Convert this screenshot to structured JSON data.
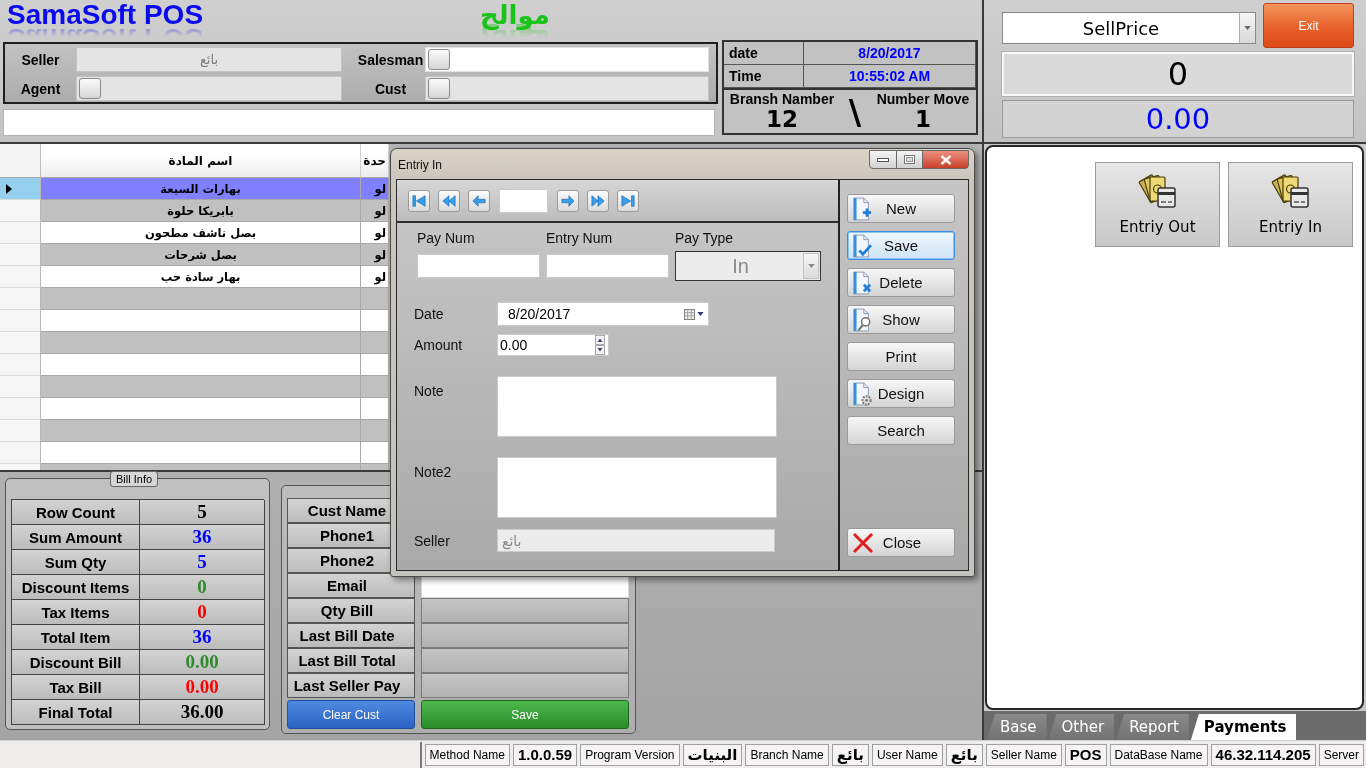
{
  "header": {
    "logo": "SamaSoft POS",
    "brand": "موالح"
  },
  "seller_form": {
    "fields": [
      {
        "label": "Seller",
        "kind": "text",
        "value": "بائع",
        "disabled": true
      },
      {
        "label": "Salesman",
        "kind": "lookup",
        "disabled": false
      },
      {
        "label": "Agent",
        "kind": "lookup",
        "disabled": true
      },
      {
        "label": "Cust",
        "kind": "lookup",
        "disabled": true
      }
    ]
  },
  "doc_info": {
    "rows": [
      {
        "label": "date",
        "value": "8/20/2017"
      },
      {
        "label": "Time",
        "value": "10:55:02 AM"
      }
    ],
    "branch_label": "Bransh Namber",
    "branch": "12",
    "separator": "\\",
    "move_label": "Number Move",
    "move": "1"
  },
  "price_panel": {
    "price_type": "SellPrice",
    "exit": "Exit",
    "quantity": "0",
    "total": "0.00"
  },
  "grid": {
    "columns": [
      "اسم المادة",
      "حدة"
    ],
    "rows": [
      {
        "cells": [
          "بهارات السبعة",
          "لو"
        ],
        "selected": true
      },
      {
        "cells": [
          "بابريكا حلوة",
          "لو"
        ],
        "selected": false
      },
      {
        "cells": [
          "بصل ناشف مطحون",
          "لو"
        ],
        "selected": false
      },
      {
        "cells": [
          "بصل شرحات",
          "لو"
        ],
        "selected": false
      },
      {
        "cells": [
          "بهار سادة حب",
          "لو"
        ],
        "selected": false
      }
    ]
  },
  "dialog": {
    "title": "Entriy In",
    "top_fields": [
      {
        "label": "Pay Num",
        "kind": "text",
        "disabled": false
      },
      {
        "label": "Entry Num",
        "kind": "text",
        "disabled": false
      },
      {
        "label": "Pay Type",
        "kind": "combo",
        "value": "In",
        "disabled": true
      }
    ],
    "fields": [
      {
        "label": "Date",
        "kind": "date",
        "value": "8/20/2017",
        "disabled": false
      },
      {
        "label": "Amount",
        "kind": "number",
        "value": "0.00",
        "disabled": false
      },
      {
        "label": "Note",
        "kind": "memo",
        "disabled": false
      },
      {
        "label": "Note2",
        "kind": "memo",
        "disabled": false
      },
      {
        "label": "Seller",
        "kind": "text",
        "value": "بائع",
        "disabled": true
      }
    ],
    "buttons": [
      {
        "label": "New",
        "kind": "new",
        "focused": false
      },
      {
        "label": "Save",
        "kind": "save",
        "focused": true
      },
      {
        "label": "Delete",
        "kind": "delete",
        "focused": false
      },
      {
        "label": "Show",
        "kind": "show",
        "focused": false
      },
      {
        "label": "Print",
        "kind": "print",
        "focused": false
      },
      {
        "label": "Design",
        "kind": "design",
        "focused": false
      },
      {
        "label": "Search",
        "kind": "search",
        "focused": false
      },
      {
        "label": "Close",
        "kind": "close",
        "focused": false
      }
    ]
  },
  "bill_info": {
    "title": "Bill Info",
    "rows": [
      {
        "label": "Row Count",
        "value": "5",
        "color": "#000000"
      },
      {
        "label": "Sum Amount",
        "value": "36",
        "color": "#0000ff"
      },
      {
        "label": "Sum Qty",
        "value": "5",
        "color": "#0000ff"
      },
      {
        "label": "Discount Items",
        "value": "0",
        "color": "#2e8b2e"
      },
      {
        "label": "Tax Items",
        "value": "0",
        "color": "#ff0000"
      },
      {
        "label": "Total Item",
        "value": "36",
        "color": "#0000ff"
      },
      {
        "label": "Discount Bill",
        "value": "0.00",
        "color": "#2e8b2e"
      },
      {
        "label": "Tax Bill",
        "value": "0.00",
        "color": "#ff0000"
      },
      {
        "label": "Final Total",
        "value": "36.00",
        "color": "#000000"
      }
    ]
  },
  "customer": {
    "rows": [
      {
        "label": "Cust Name",
        "kind": "covered"
      },
      {
        "label": "Phone1",
        "kind": "covered"
      },
      {
        "label": "Phone2",
        "kind": "covered"
      },
      {
        "label": "Email",
        "kind": "active"
      },
      {
        "label": "Qty Bill",
        "kind": "idle"
      },
      {
        "label": "Last Bill Date",
        "kind": "idle"
      },
      {
        "label": "Last Bill Total",
        "kind": "idle"
      },
      {
        "label": "Last Seller Pay",
        "kind": "idle"
      }
    ],
    "buttons": [
      {
        "label": "Clear Cust",
        "kind": "clear"
      },
      {
        "label": "Save",
        "kind": "save"
      }
    ]
  },
  "payment_buttons": [
    {
      "label": "Entriy Out"
    },
    {
      "label": "Entriy In"
    }
  ],
  "tabs": [
    {
      "label": "Base",
      "selected": false
    },
    {
      "label": "Other",
      "selected": false
    },
    {
      "label": "Report",
      "selected": false
    },
    {
      "label": "Payments",
      "selected": true
    }
  ],
  "status_bar": {
    "items": [
      {
        "text": "Method Name",
        "kind": "label"
      },
      {
        "text": "1.0.0.59",
        "kind": "value"
      },
      {
        "text": "Program Version",
        "kind": "label"
      },
      {
        "text": "البنيات",
        "kind": "value"
      },
      {
        "text": "Branch Name",
        "kind": "label"
      },
      {
        "text": "بائع",
        "kind": "value"
      },
      {
        "text": "User Name",
        "kind": "label"
      },
      {
        "text": "بائع",
        "kind": "value"
      },
      {
        "text": "Seller Name",
        "kind": "label"
      },
      {
        "text": "POS",
        "kind": "value"
      },
      {
        "text": "DataBase Name",
        "kind": "label"
      },
      {
        "text": "46.32.114.205",
        "kind": "value"
      },
      {
        "text": "Server",
        "kind": "label"
      }
    ]
  }
}
